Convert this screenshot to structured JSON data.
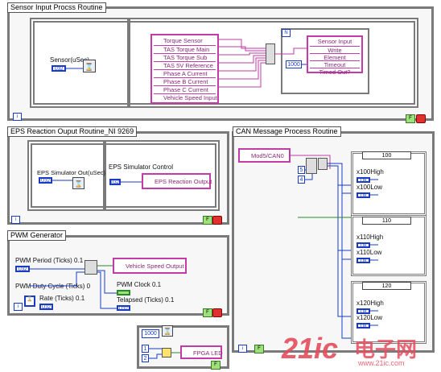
{
  "sections": {
    "sensor": {
      "title": "Sensor Input Procss Routine",
      "control": "Sensor(uSec)",
      "build_items": [
        "Torque Sensor",
        "TAS Torque Main",
        "TAS Torque Sub",
        "TAS 5V Reference",
        "Phase A Current",
        "Phase B Current",
        "Phase C Current",
        "Vehicle Speed Input"
      ],
      "node_title": "Sensor Input",
      "node_items": [
        "Write",
        "Element",
        "Timeout",
        "Timed Out?"
      ],
      "timeout_const": "1000",
      "case_index": "N"
    },
    "eps": {
      "title": "EPS Reaction Ouput Routine_NI 9269",
      "control": "EPS Simulator Out(uSec)",
      "frame_title": "EPS Simulator Control",
      "output": "EPS Reaction Output"
    },
    "pwm": {
      "title": "PWM Generator",
      "period": "PWM Period (Ticks) 0.1",
      "duty": "PWM Duty Cycle (Ticks) 0",
      "rate": "Rate (Ticks) 0.1",
      "output": "Vehicle Speed Output",
      "clock": "PWM Clock 0.1",
      "telapsed": "Telapsed (Ticks) 0.1"
    },
    "led": {
      "const": "1000",
      "output": "FPGA LED"
    },
    "can": {
      "title": "CAN Message Process Routine",
      "source": "Mod5/CAN0",
      "const_a": "5",
      "const_b": "4",
      "cases": [
        {
          "selector": "100",
          "high": "x100High",
          "low": "x100Low"
        },
        {
          "selector": "110",
          "high": "x110High",
          "low": "x110Low"
        },
        {
          "selector": "120",
          "high": "x120High",
          "low": "x120Low"
        }
      ]
    }
  },
  "watermark": {
    "text_a": "21ic",
    "text_b": "电子网",
    "url": "www.21ic.com"
  },
  "colors": {
    "loop_border": "#7a7a7a",
    "pink": "#c23ba6",
    "blue": "#1a3cc4",
    "wire_pink": "#c23ba6",
    "wire_blue": "#1a3cc4",
    "wire_green": "#2a8a2a"
  }
}
